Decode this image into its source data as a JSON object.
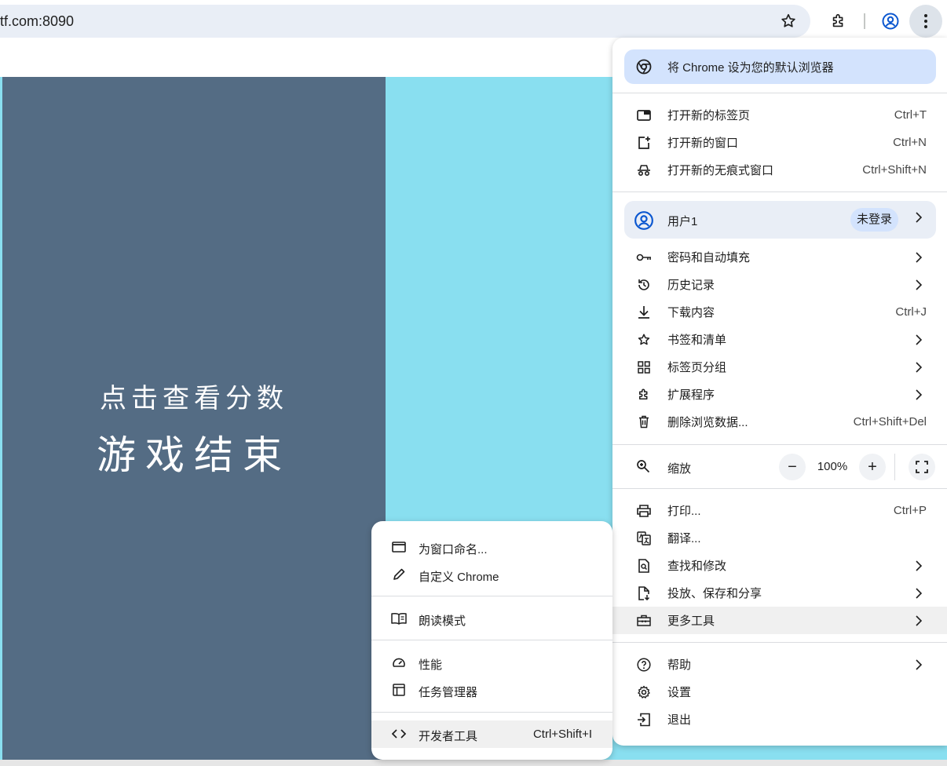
{
  "toolbar": {
    "url": "tf.com:8090",
    "icons": [
      "bookmark-star-icon",
      "extensions-icon",
      "profile-icon",
      "more-vert-icon"
    ]
  },
  "game": {
    "subtitle": "点击查看分数",
    "title": "游戏结束",
    "panel_color": "#546c84",
    "background_color": "#89dff0"
  },
  "menu": {
    "default_browser": "将 Chrome 设为您的默认浏览器",
    "new_tab": {
      "label": "打开新的标签页",
      "shortcut": "Ctrl+T"
    },
    "new_window": {
      "label": "打开新的窗口",
      "shortcut": "Ctrl+N"
    },
    "incognito": {
      "label": "打开新的无痕式窗口",
      "shortcut": "Ctrl+Shift+N"
    },
    "profile": {
      "name": "用户1",
      "status": "未登录"
    },
    "passwords": {
      "label": "密码和自动填充"
    },
    "history": {
      "label": "历史记录"
    },
    "downloads": {
      "label": "下载内容",
      "shortcut": "Ctrl+J"
    },
    "bookmarks": {
      "label": "书签和清单"
    },
    "tab_groups": {
      "label": "标签页分组"
    },
    "extensions": {
      "label": "扩展程序"
    },
    "clear_data": {
      "label": "删除浏览数据...",
      "shortcut": "Ctrl+Shift+Del"
    },
    "zoom": {
      "label": "缩放",
      "value": "100%",
      "minus": "−",
      "plus": "+"
    },
    "print": {
      "label": "打印...",
      "shortcut": "Ctrl+P"
    },
    "translate": {
      "label": "翻译..."
    },
    "find": {
      "label": "查找和修改"
    },
    "cast": {
      "label": "投放、保存和分享"
    },
    "more_tools": {
      "label": "更多工具"
    },
    "help": {
      "label": "帮助"
    },
    "settings": {
      "label": "设置"
    },
    "exit": {
      "label": "退出"
    }
  },
  "submenu": {
    "name_window": {
      "label": "为窗口命名..."
    },
    "customize": {
      "label": "自定义 Chrome"
    },
    "reading_mode": {
      "label": "朗读模式"
    },
    "performance": {
      "label": "性能"
    },
    "task_manager": {
      "label": "任务管理器"
    },
    "dev_tools": {
      "label": "开发者工具",
      "shortcut": "Ctrl+Shift+I"
    }
  },
  "colors": {
    "accent_blue": "#0b57d0",
    "banner_bg": "#d3e3fd",
    "profile_bg": "#e9eef6"
  }
}
